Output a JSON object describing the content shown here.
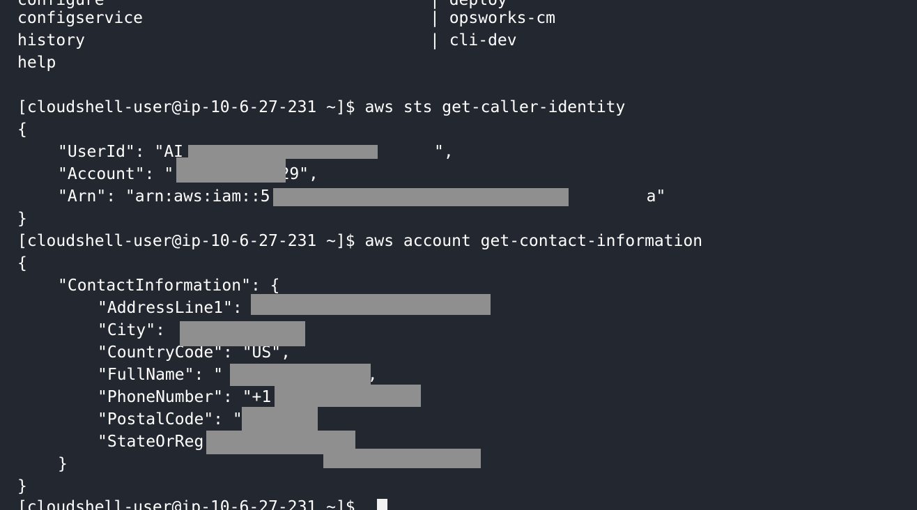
{
  "terminal": {
    "help_lines": [
      {
        "left": "configure",
        "right": "| deploy"
      },
      {
        "left": "configservice",
        "right": "| opsworks-cm"
      },
      {
        "left": "history",
        "right": "| cli-dev"
      },
      {
        "left": "help",
        "right": ""
      }
    ],
    "sts": {
      "prompt": "[cloudshell-user@ip-10-6-27-231 ~]$ aws sts get-caller-identity",
      "open": "{",
      "userid": "\"UserId\": \"AI                          \",",
      "account": "\"Account\": \"           29\",",
      "arn": "\"Arn\": \"arn:aws:iam::5                                       a\"",
      "close": "}"
    },
    "contact": {
      "prompt": "[cloudshell-user@ip-10-6-27-231 ~]$ aws account get-contact-information",
      "open": "{",
      "section": "\"ContactInformation\": {",
      "address": "\"AddressLine1\":                        ,",
      "city": "\"City\":             ,",
      "country": "\"CountryCode\": \"US\",",
      "fullname": "\"FullName\": \"              \",",
      "phone": "\"PhoneNumber\": \"+1",
      "postal": "\"PostalCode\": \"",
      "state": "\"StateOrReg",
      "section_close": "}",
      "close": "}"
    },
    "final_prompt": "[cloudshell-user@ip-10-6-27-231 ~]$ "
  },
  "colors": {
    "background": "#232730",
    "text": "#ffffff",
    "redaction": "#8f8f8f"
  }
}
